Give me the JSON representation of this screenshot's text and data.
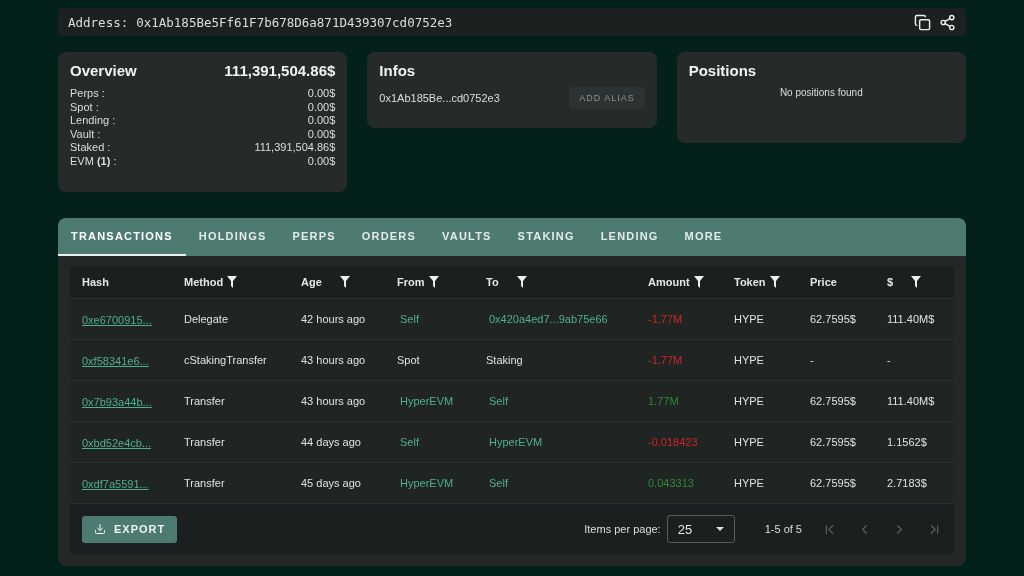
{
  "address_bar": {
    "label": "Address:",
    "value": "0x1Ab185Be5Ff61F7b678D6a871D439307cd0752e3"
  },
  "overview": {
    "title": "Overview",
    "total": "111,391,504.86$",
    "rows": [
      {
        "label": "Perps :",
        "value": "0.00$"
      },
      {
        "label": "Spot :",
        "value": "0.00$"
      },
      {
        "label": "Lending :",
        "value": "0.00$"
      },
      {
        "label": "Vault :",
        "value": "0.00$"
      },
      {
        "label": "Staked :",
        "value": "111,391,504.86$"
      },
      {
        "label": "EVM **(1)** :",
        "value": "0.00$"
      }
    ]
  },
  "infos": {
    "title": "Infos",
    "address": "0x1Ab185Be...cd0752e3",
    "alias_button": {
      "label": "ADD ALIAS",
      "disabled": true
    }
  },
  "positions": {
    "title": "Positions",
    "empty_text": "No positions found"
  },
  "tabs": [
    {
      "label": "TRANSACTIONS",
      "selected": true
    },
    {
      "label": "HOLDINGS",
      "selected": false
    },
    {
      "label": "PERPS",
      "selected": false
    },
    {
      "label": "ORDERS",
      "selected": false
    },
    {
      "label": "VAULTS",
      "selected": false
    },
    {
      "label": "STAKING",
      "selected": false
    },
    {
      "label": "LENDING",
      "selected": false
    },
    {
      "label": "MORE",
      "selected": false
    }
  ],
  "table": {
    "columns": [
      {
        "label": "Hash",
        "filter": false
      },
      {
        "label": "Method",
        "filter": true
      },
      {
        "label": "Age",
        "filter": true
      },
      {
        "label": "From",
        "filter": true
      },
      {
        "label": "To",
        "filter": true
      },
      {
        "label": "Amount",
        "filter": true
      },
      {
        "label": "Token",
        "filter": true
      },
      {
        "label": "Price",
        "filter": false
      },
      {
        "label": "$",
        "filter": true
      }
    ],
    "rows": [
      {
        "hash": "0xe6700915...",
        "method": "Delegate",
        "age": "42 hours ago",
        "from": {
          "text": "Self",
          "kind": "account"
        },
        "to": {
          "text": "0x420a4ed7...9ab75e66",
          "kind": "account"
        },
        "amount": {
          "text": "-1.77M",
          "kind": "negative"
        },
        "token": "HYPE",
        "price": "62.7595$",
        "usd": "111.40M$"
      },
      {
        "hash": "0xf58341e6...",
        "method": "cStakingTransfer",
        "age": "43 hours ago",
        "from": {
          "text": "Spot",
          "kind": "plain"
        },
        "to": {
          "text": "Staking",
          "kind": "plain"
        },
        "amount": {
          "text": "-1.77M",
          "kind": "negative"
        },
        "token": "HYPE",
        "price": "-",
        "usd": "-"
      },
      {
        "hash": "0x7b93a44b...",
        "method": "Transfer",
        "age": "43 hours ago",
        "from": {
          "text": "HyperEVM",
          "kind": "account"
        },
        "to": {
          "text": "Self",
          "kind": "account"
        },
        "amount": {
          "text": "1.77M",
          "kind": "positive"
        },
        "token": "HYPE",
        "price": "62.7595$",
        "usd": "111.40M$"
      },
      {
        "hash": "0xbd52e4cb...",
        "method": "Transfer",
        "age": "44 days ago",
        "from": {
          "text": "Self",
          "kind": "account"
        },
        "to": {
          "text": "HyperEVM",
          "kind": "account"
        },
        "amount": {
          "text": "-0.018423",
          "kind": "negative"
        },
        "token": "HYPE",
        "price": "62.7595$",
        "usd": "1.1562$"
      },
      {
        "hash": "0xdf7a5591...",
        "method": "Transfer",
        "age": "45 days ago",
        "from": {
          "text": "HyperEVM",
          "kind": "account"
        },
        "to": {
          "text": "Self",
          "kind": "account"
        },
        "amount": {
          "text": "0.043313",
          "kind": "positive"
        },
        "token": "HYPE",
        "price": "62.7595$",
        "usd": "2.7183$"
      }
    ]
  },
  "footer": {
    "export_button": "EXPORT",
    "items_per_page_label": "Items per page:",
    "items_per_page": "25",
    "range": "1-5 of 5",
    "first_disabled": true,
    "prev_disabled": true,
    "next_disabled": true,
    "last_disabled": true
  }
}
